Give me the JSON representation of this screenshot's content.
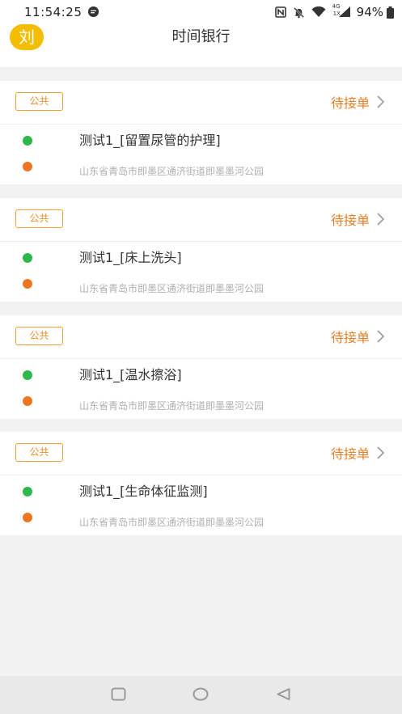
{
  "status_bar": {
    "time": "11:54:25",
    "network_label_top": "4G",
    "network_label_bottom": "1X",
    "battery": "94%"
  },
  "header": {
    "avatar_text": "刘",
    "title": "时间银行"
  },
  "orders": [
    {
      "tag": "公共",
      "status": "待接单",
      "title": "测试1_[留置尿管的护理]",
      "address": "山东省青岛市即墨区通济街道即墨墨河公园"
    },
    {
      "tag": "公共",
      "status": "待接单",
      "title": "测试1_[床上洗头]",
      "address": "山东省青岛市即墨区通济街道即墨墨河公园"
    },
    {
      "tag": "公共",
      "status": "待接单",
      "title": "测试1_[温水擦浴]",
      "address": "山东省青岛市即墨区通济街道即墨墨河公园"
    },
    {
      "tag": "公共",
      "status": "待接单",
      "title": "测试1_[生命体征监测]",
      "address": "山东省青岛市即墨区通济街道即墨墨河公园"
    }
  ],
  "colors": {
    "accent": "#e8802a",
    "avatar": "#f5bd00",
    "dot_start": "#2fb84a",
    "dot_end": "#ee7622"
  }
}
